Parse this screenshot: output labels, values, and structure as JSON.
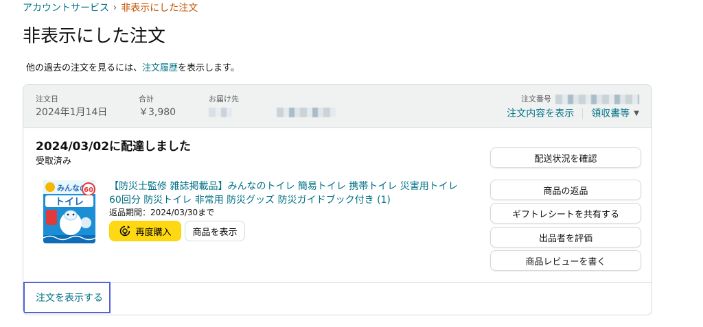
{
  "breadcrumb": {
    "parent": "アカウントサービス",
    "separator": "›",
    "current": "非表示にした注文"
  },
  "page_title": "非表示にした注文",
  "info": {
    "prefix": "他の過去の注文を見るには、",
    "link": "注文履歴",
    "suffix": "を表示します。"
  },
  "order": {
    "header": {
      "date_label": "注文日",
      "date_value": "2024年1月14日",
      "total_label": "合計",
      "total_value": "￥3,980",
      "ship_to_label": "お届け先",
      "order_no_label": "注文番号",
      "view_details_link": "注文内容を表示",
      "receipt_link": "領収書等"
    },
    "delivery_status": "2024/03/02に配達しました",
    "delivery_sub": "受取済み",
    "product": {
      "title": "【防災士監修 雑誌掲載品】みんなのトイレ 簡易トイレ 携帯トイレ 災害用トイレ 60回分 防災トイレ 非常用 防災グッズ 防災ガイドブック付き (1)",
      "return_info": "返品期間：2024/03/30まで",
      "image_text_top": "みんなの",
      "image_text_main": "トイレ",
      "image_badge": "60",
      "buy_again_label": "再度購入",
      "view_item_label": "商品を表示"
    },
    "actions": {
      "track": "配送状況を確認",
      "return": "商品の返品",
      "gift_receipt": "ギフトレシートを共有する",
      "rate_seller": "出品者を評価",
      "write_review": "商品レビューを書く"
    },
    "footer_link": "注文を表示する"
  },
  "colors": {
    "link": "#007185",
    "breadcrumb_current": "#c45500",
    "buy_again_bg": "#ffd814",
    "header_bg": "#f0f2f2",
    "focus_outline": "#5562d6"
  },
  "icons": {
    "buy_again": "reorder-cycle-icon",
    "receipt_chevron": "chevron-down-icon"
  }
}
